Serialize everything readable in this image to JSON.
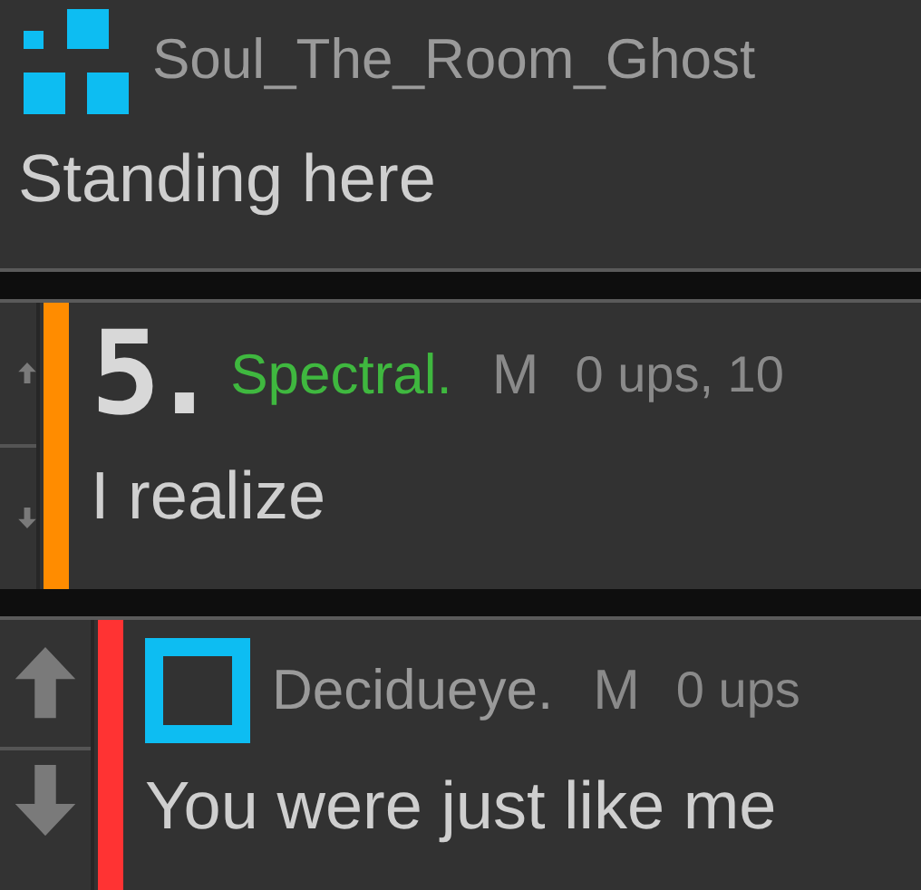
{
  "comments": [
    {
      "avatar": {
        "kind": "blocks"
      },
      "author": {
        "name": "Soul_The_Room_Ghost",
        "color": "#9a9a9a"
      },
      "text": "Standing here",
      "vote_column": {
        "kind": "none"
      }
    },
    {
      "avatar": {
        "kind": "text",
        "text": "5."
      },
      "author": {
        "name": "Spectral.",
        "color": "#3fb83f"
      },
      "flag": "M",
      "meta": "0 ups, 10",
      "text": "I realize",
      "vote_column": {
        "kind": "cropped"
      },
      "color": "#ff8c00"
    },
    {
      "avatar": {
        "kind": "frame"
      },
      "author": {
        "name": "Decidueye.",
        "color": "#9a9a9a"
      },
      "flag": "M",
      "meta": "0 ups",
      "text": "You were just like me",
      "vote_column": {
        "kind": "full"
      },
      "color": "#ff3333"
    }
  ]
}
